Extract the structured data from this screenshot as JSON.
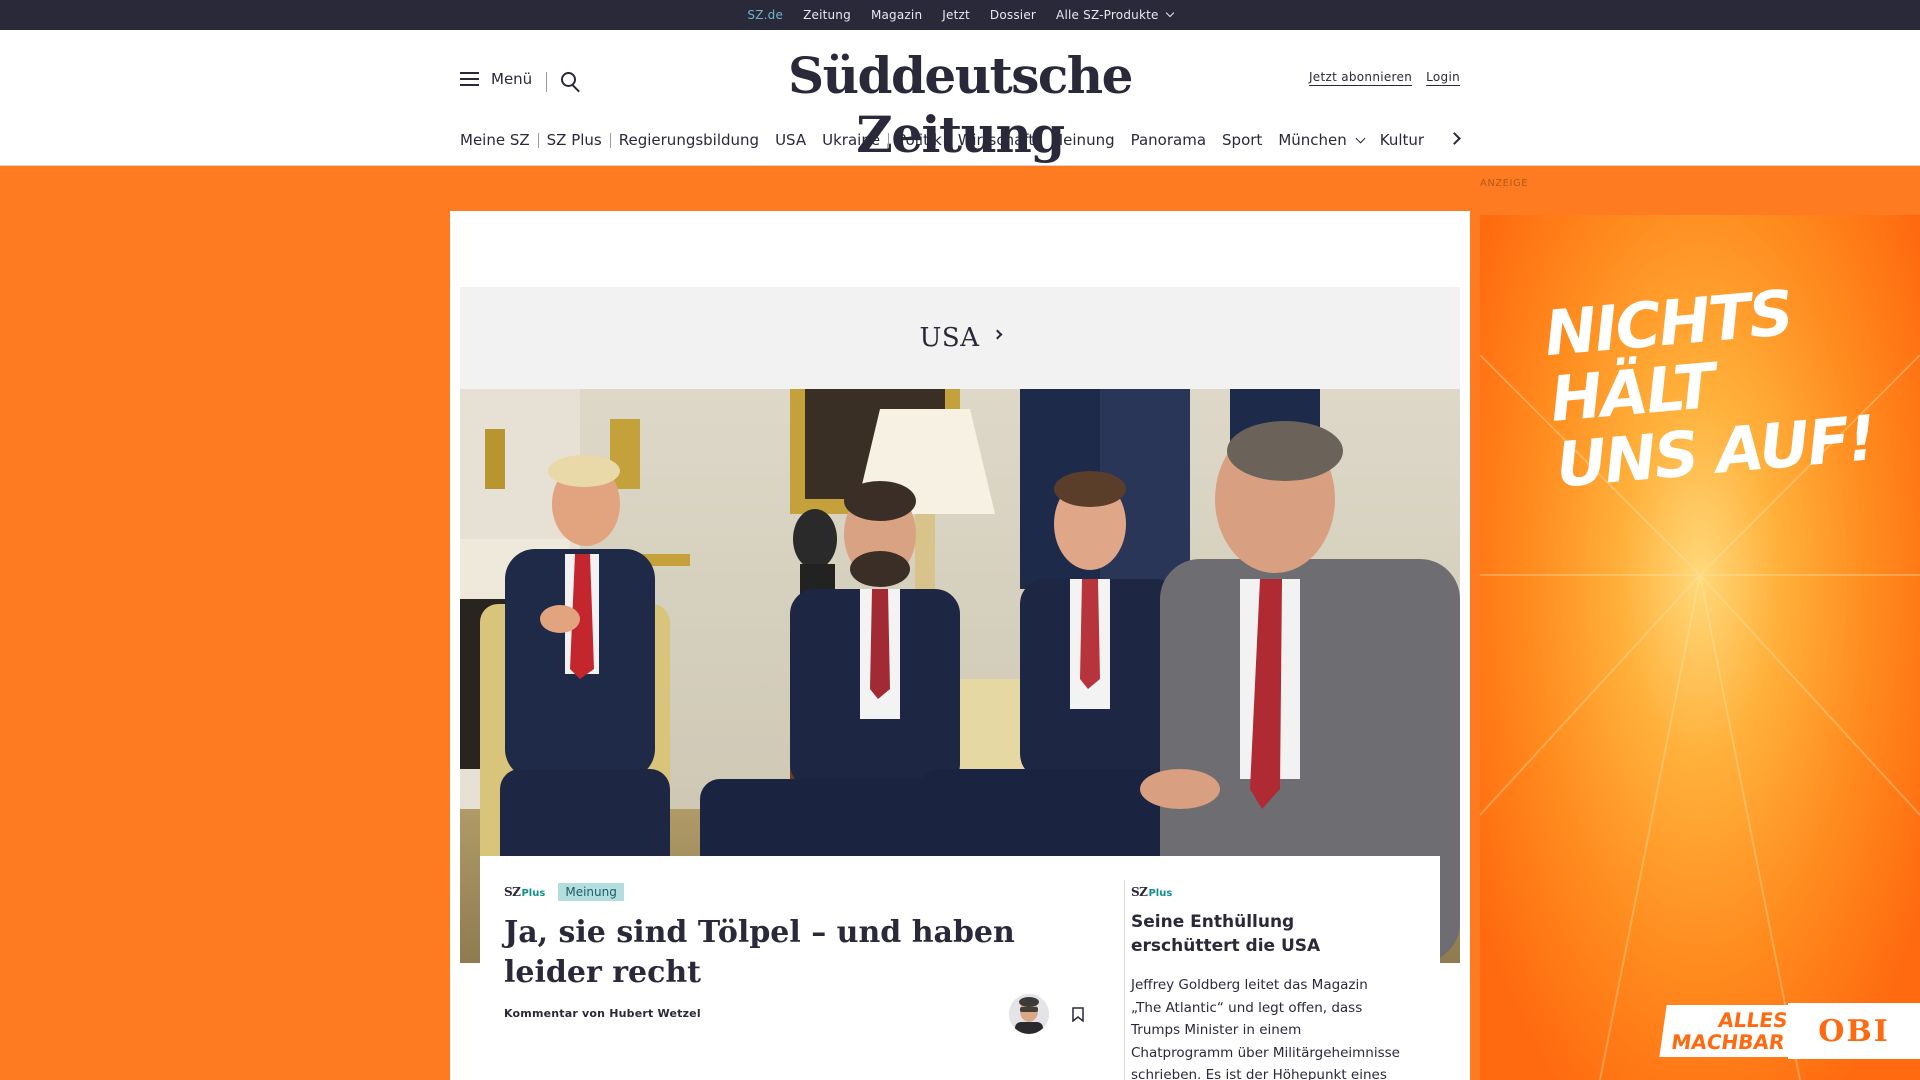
{
  "topbar": {
    "links": [
      "SZ.de",
      "Zeitung",
      "Magazin",
      "Jetzt",
      "Dossier",
      "Alle SZ-Produkte"
    ]
  },
  "header": {
    "menu_label": "Menü",
    "logo": "Süddeutsche Zeitung",
    "subscribe_label": "Jetzt abonnieren",
    "login_label": "Login",
    "nav": [
      "Meine SZ",
      "SZ Plus",
      "Regierungsbildung",
      "USA",
      "Ukraine",
      "Politik",
      "Wirtschaft",
      "Meinung",
      "Panorama",
      "Sport",
      "München",
      "Kultur"
    ]
  },
  "ad": {
    "label": "ANZEIGE",
    "slogan_line1": "NICHTS HÄLT",
    "slogan_line2": "UNS AUF!",
    "alles": "ALLES",
    "machbar": "MACHBAR",
    "brand": "OBI"
  },
  "section": {
    "title": "USA"
  },
  "teaser": {
    "sz_mark": "SZ",
    "plus_mark": "Plus",
    "badge": "Meinung",
    "headline": "Ja, sie sind Tölpel – und haben leider recht",
    "byline": "Kommentar von Hubert Wetzel"
  },
  "side_teaser": {
    "sz_mark": "SZ",
    "plus_mark": "Plus",
    "headline": "Seine Enthüllung erschüttert die USA",
    "text": "Jeffrey Goldberg leitet das Magazin „The Atlantic“ und legt offen, dass Trumps Minister in einem Chatprogramm über Militärgeheimnisse schrieben. Es ist der Höhepunkt eines erfolgreichen"
  },
  "colors": {
    "dark": "#29293a",
    "page_bg": "#ff7b22",
    "accent_teal": "#6fb3c9",
    "badge_bg": "#b4dde0"
  }
}
